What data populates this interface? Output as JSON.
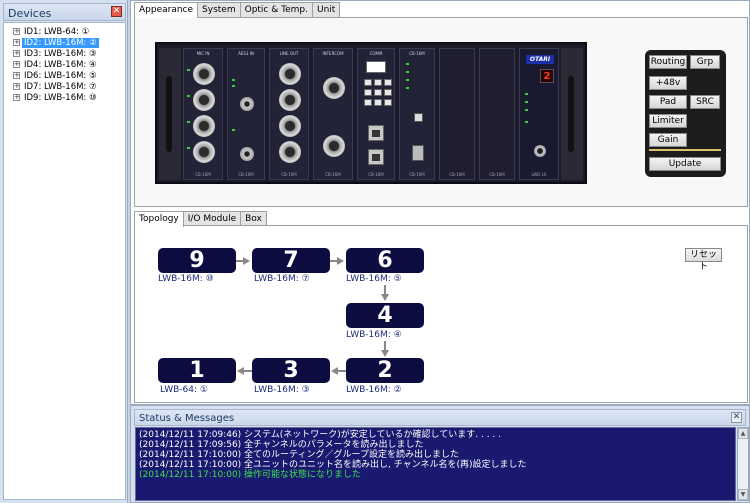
{
  "devices": {
    "title": "Devices",
    "items": [
      {
        "label": "ID1: LWB-64: ①",
        "selected": false
      },
      {
        "label": "ID2: LWB-16M: ②",
        "selected": true
      },
      {
        "label": "ID3: LWB-16M: ③",
        "selected": false
      },
      {
        "label": "ID4: LWB-16M: ④",
        "selected": false
      },
      {
        "label": "ID6: LWB-16M: ⑤",
        "selected": false
      },
      {
        "label": "ID7: LWB-16M: ⑦",
        "selected": false
      },
      {
        "label": "ID9: LWB-16M: ⑩",
        "selected": false
      }
    ]
  },
  "top_tabs": [
    "Appearance",
    "System",
    "Optic & Temp.",
    "Unit"
  ],
  "rack": {
    "modules": [
      "MIC IN",
      "AES3 IN",
      "LINE OUT",
      "INTERCOM",
      "CB-16M"
    ],
    "module_bottoms": [
      "CB-16M",
      "CB-16M",
      "CB-16M",
      "CB-16M",
      "CB-16M",
      "CB-16M",
      "CB-16M",
      "LWB-16"
    ],
    "brand": "OTARI",
    "id_display": "2"
  },
  "controls": {
    "routing": "Routing",
    "grp": "Grp",
    "p48v": "+48v",
    "pad": "Pad",
    "src": "SRC",
    "limiter": "Limiter",
    "gain": "Gain",
    "update": "Update"
  },
  "bottom_tabs": [
    "Topology",
    "I/O Module",
    "Box"
  ],
  "topology": {
    "reset": "リセット",
    "nodes": [
      {
        "num": "9",
        "label": "LWB-16M: ⑩"
      },
      {
        "num": "7",
        "label": "LWB-16M: ⑦"
      },
      {
        "num": "6",
        "label": "LWB-16M: ⑤"
      },
      {
        "num": "4",
        "label": "LWB-16M: ④"
      },
      {
        "num": "2",
        "label": "LWB-16M: ②"
      },
      {
        "num": "3",
        "label": "LWB-16M: ③"
      },
      {
        "num": "1",
        "label": "LWB-64: ①"
      }
    ]
  },
  "status": {
    "title": "Status & Messages",
    "messages": [
      {
        "text": "(2014/12/11 17:09:46) システム(ネットワーク)が安定しているか確認しています. . . . .",
        "color": "white"
      },
      {
        "text": "(2014/12/11 17:09:56) 全チャンネルのパラメータを読み出しました",
        "color": "white"
      },
      {
        "text": "(2014/12/11 17:10:00) 全てのルーティング／グループ設定を読み出しました",
        "color": "white"
      },
      {
        "text": "(2014/12/11 17:10:00) 全ユニットのユニット名を読み出し, チャンネル名を(再)設定しました",
        "color": "white"
      },
      {
        "text": "(2014/12/11 17:10:00) 操作可能な状態になりました",
        "color": "green"
      }
    ]
  }
}
